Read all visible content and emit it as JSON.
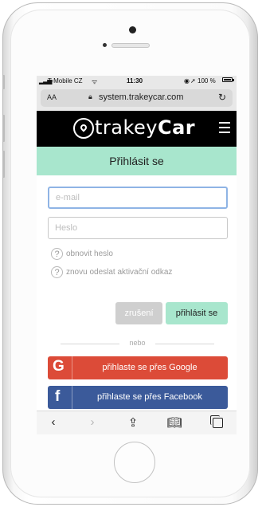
{
  "status_bar": {
    "carrier": "T-Mobile CZ",
    "time": "11:30",
    "battery": "100 %"
  },
  "url_bar": {
    "aa": "AA",
    "url": "system.trakeycar.com"
  },
  "brand": {
    "name_part1": "trakey",
    "name_part2": "Car"
  },
  "login": {
    "header": "Přihlásit se",
    "email_placeholder": "e-mail",
    "password_placeholder": "Heslo",
    "reset_password": "obnovit heslo",
    "resend_activation": "znovu odeslat aktivační odkaz",
    "cancel_label": "zrušení",
    "submit_label": "přihlásit se",
    "or_label": "nebo",
    "google_label": "přihlaste se přes Google",
    "facebook_label": "přihlaste se přes Facebook"
  },
  "colors": {
    "accent": "#a8e6cd",
    "google": "#dc4b38",
    "facebook": "#3b5a9a",
    "brand_bar": "#000000"
  },
  "icons": {
    "google": "G",
    "facebook": "f"
  }
}
